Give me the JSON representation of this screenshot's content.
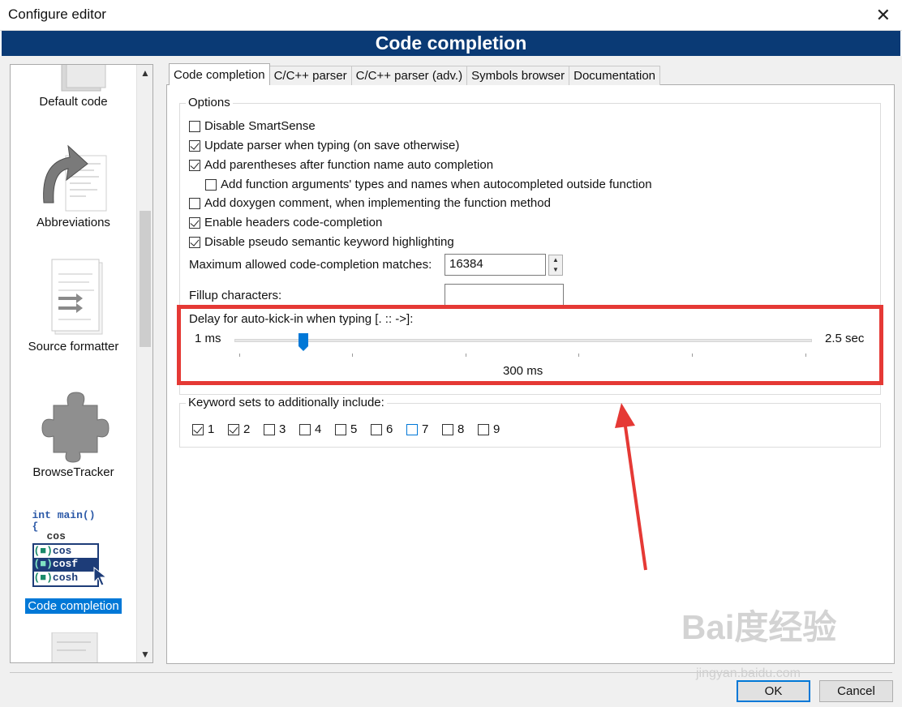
{
  "window": {
    "title": "Configure editor",
    "close_glyph": "✕"
  },
  "header": {
    "title": "Code completion"
  },
  "sidebar": {
    "items": [
      {
        "label": "Default code",
        "icon": "default-code-icon",
        "selected": false
      },
      {
        "label": "Abbreviations",
        "icon": "abbreviations-icon",
        "selected": false
      },
      {
        "label": "Source formatter",
        "icon": "source-formatter-icon",
        "selected": false
      },
      {
        "label": "BrowseTracker",
        "icon": "puzzle-icon",
        "selected": false
      },
      {
        "label": "Code completion",
        "icon": "code-completion-icon",
        "selected": true
      }
    ],
    "code_icon_lines": [
      "int main()",
      "{",
      "cos",
      "cos",
      "cosf",
      "cosh"
    ]
  },
  "tabs": [
    {
      "label": "Code completion",
      "active": true
    },
    {
      "label": "C/C++ parser",
      "active": false
    },
    {
      "label": "C/C++ parser (adv.)",
      "active": false
    },
    {
      "label": "Symbols browser",
      "active": false
    },
    {
      "label": "Documentation",
      "active": false
    }
  ],
  "options": {
    "group_title": "Options",
    "checkboxes": [
      {
        "label": "Disable SmartSense",
        "checked": false
      },
      {
        "label": "Update parser when typing (on save otherwise)",
        "checked": true
      },
      {
        "label": "Add parentheses after function name auto completion",
        "checked": true
      },
      {
        "label": "Add function arguments' types and names when autocompleted outside function",
        "checked": false
      },
      {
        "label": "Add doxygen comment, when implementing the function method",
        "checked": false
      },
      {
        "label": "Enable headers code-completion",
        "checked": true
      },
      {
        "label": "Disable pseudo semantic keyword highlighting",
        "checked": true
      }
    ],
    "max_matches_label": "Maximum allowed code-completion matches:",
    "max_matches_value": "16384",
    "fillup_label": "Fillup characters:",
    "fillup_value": "",
    "delay_label": "Delay for auto-kick-in when typing [. :: ->]:",
    "delay_min": "1 ms",
    "delay_max": "2.5 sec",
    "delay_value": "300 ms",
    "delay_fraction": 0.12
  },
  "keywords": {
    "group_title": "Keyword sets to additionally include:",
    "sets": [
      {
        "label": "1",
        "checked": true
      },
      {
        "label": "2",
        "checked": true
      },
      {
        "label": "3",
        "checked": false
      },
      {
        "label": "4",
        "checked": false
      },
      {
        "label": "5",
        "checked": false
      },
      {
        "label": "6",
        "checked": false
      },
      {
        "label": "7",
        "checked": false,
        "focus": true
      },
      {
        "label": "8",
        "checked": false
      },
      {
        "label": "9",
        "checked": false
      }
    ]
  },
  "buttons": {
    "ok": "OK",
    "cancel": "Cancel"
  },
  "scroll": {
    "up": "▲",
    "down": "▼"
  },
  "spin": {
    "up": "▲",
    "down": "▼"
  },
  "watermark": {
    "brand": "Bai度经验",
    "url": "jingyan.baidu.com"
  },
  "colors": {
    "accent": "#0078d7",
    "header_band": "#0a3a75",
    "highlight": "#e53935"
  }
}
